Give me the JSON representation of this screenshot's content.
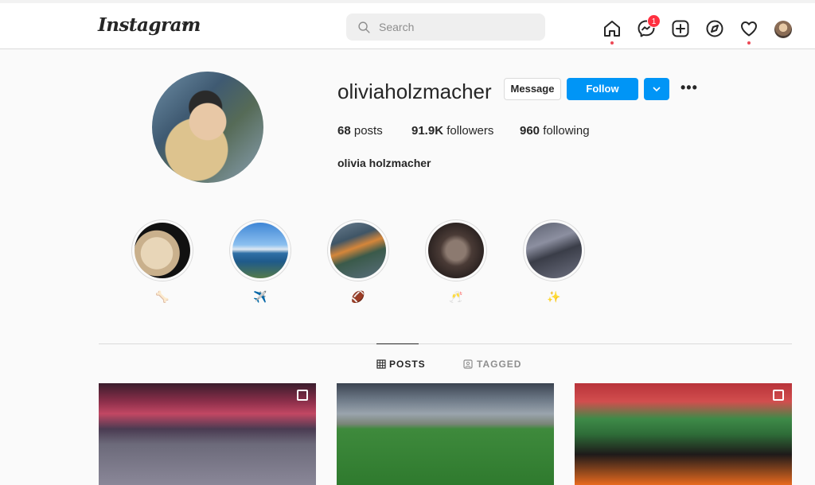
{
  "nav": {
    "logo": "Instagram",
    "search_placeholder": "Search",
    "messenger_badge": "1",
    "icons": [
      "home-icon",
      "messenger-icon",
      "new-post-icon",
      "explore-icon",
      "activity-heart-icon",
      "profile-avatar"
    ]
  },
  "profile": {
    "username": "oliviaholzmacher",
    "message_label": "Message",
    "follow_label": "Follow",
    "more_label": "•••",
    "stats": {
      "posts_count": "68",
      "posts_label": "posts",
      "followers_count": "91.9K",
      "followers_label": "followers",
      "following_count": "960",
      "following_label": "following"
    },
    "full_name": "olivia holzmacher"
  },
  "highlights": [
    {
      "label": "🦴"
    },
    {
      "label": "✈️"
    },
    {
      "label": "🏈"
    },
    {
      "label": "🥂"
    },
    {
      "label": "✨"
    }
  ],
  "tabs": [
    {
      "label": "POSTS",
      "active": true
    },
    {
      "label": "TAGGED",
      "active": false
    }
  ],
  "colors": {
    "accent": "#0095f6",
    "badge": "#ff3040",
    "text": "#262626",
    "muted": "#8e8e8e"
  }
}
